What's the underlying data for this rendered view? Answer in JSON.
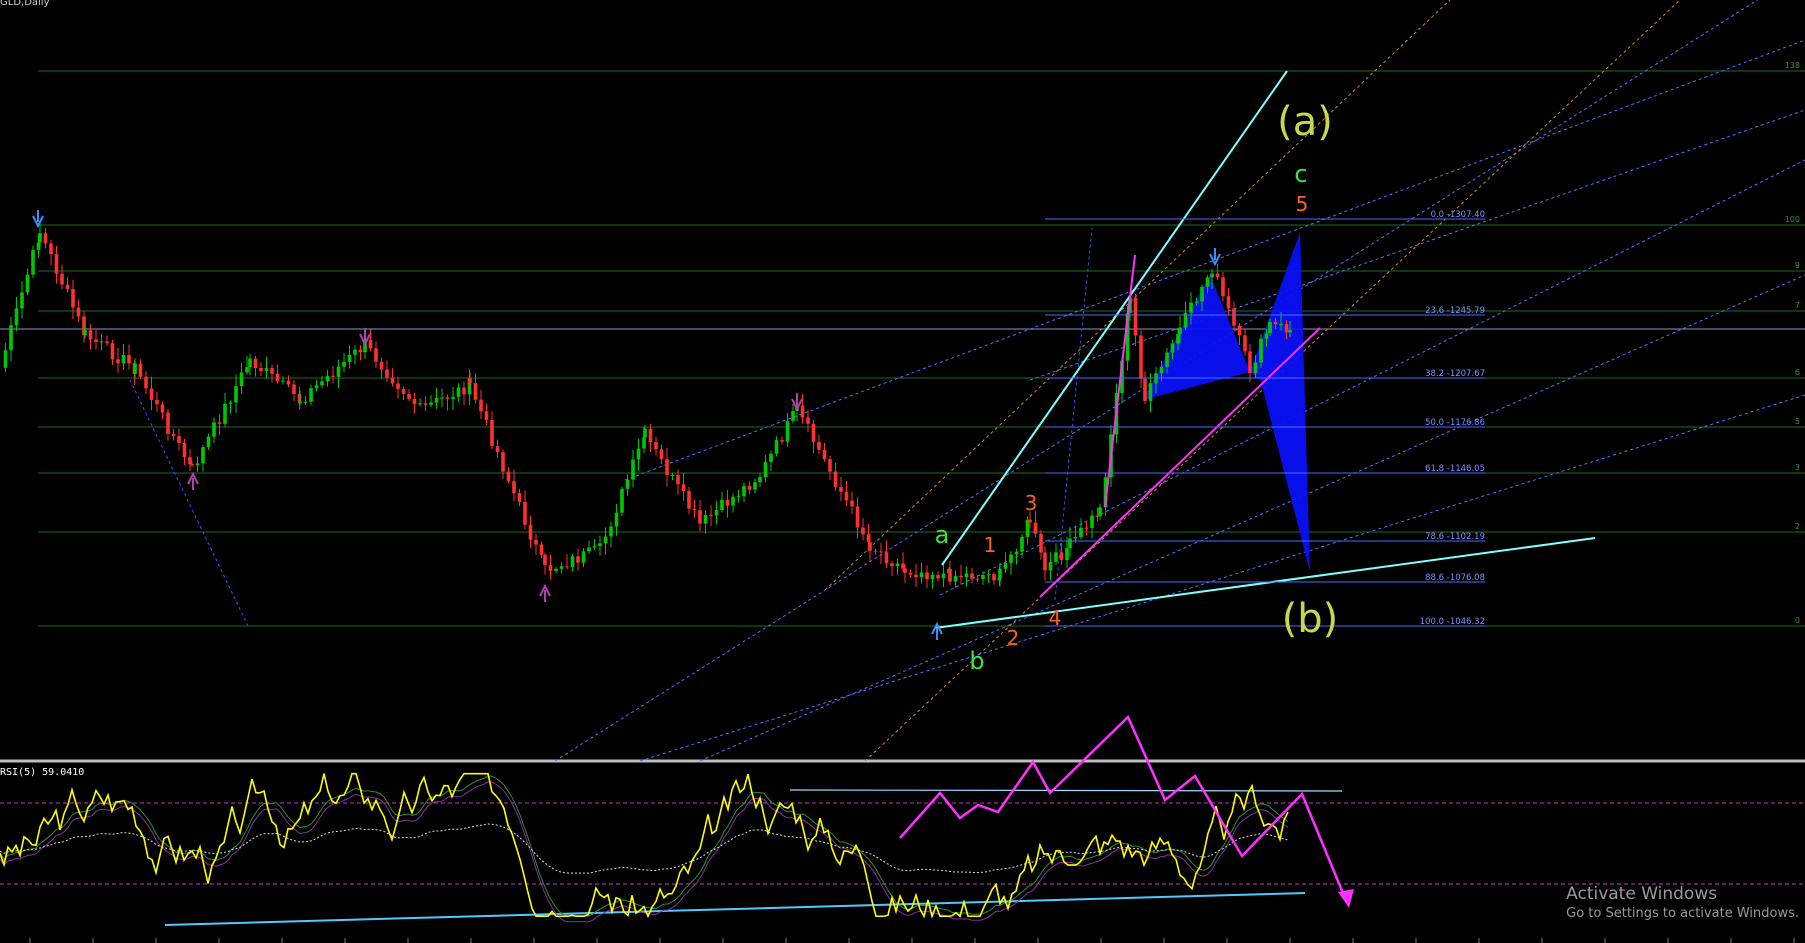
{
  "header": {
    "symbol_title": "GLD,Daily",
    "oscillator_title": "RSI(5) 59.0410"
  },
  "watermark": {
    "line1": "Activate Windows",
    "line2": "Go to Settings to activate Windows."
  },
  "colors": {
    "background": "#000000",
    "up_candle": "#00c800",
    "down_candle": "#ff3030",
    "fib_line": "#4a6cff",
    "green_level": "#1f6b1f",
    "trend_cyan": "#7fffff",
    "magenta": "#ff30ff",
    "pattern_blue": "#0a10ff",
    "rsi": "#ffff00",
    "orange_dotted": "#d08a10"
  },
  "chart_data": {
    "type": "candlestick",
    "price_ylim": [
      960,
      1480
    ],
    "fibonacci_levels": [
      {
        "label": "0.0 -1307.40",
        "level": 0.0,
        "price": 1307.4
      },
      {
        "label": "23.6 -1245.79",
        "level": 23.6,
        "price": 1245.79
      },
      {
        "label": "38.2 -1207.67",
        "level": 38.2,
        "price": 1207.67
      },
      {
        "label": "50.0 -1176.86",
        "level": 50.0,
        "price": 1176.86
      },
      {
        "label": "61.8 -1146.05",
        "level": 61.8,
        "price": 1146.05
      },
      {
        "label": "78.6 -1102.19",
        "level": 78.6,
        "price": 1102.19
      },
      {
        "label": "88.6 -1076.08",
        "level": 88.6,
        "price": 1076.08
      },
      {
        "label": "100.0 -1046.32",
        "level": 100.0,
        "price": 1046.32
      }
    ],
    "right_edge_labels": [
      "138",
      "100",
      "9",
      "7",
      "6",
      "5",
      "3",
      "2",
      "0"
    ],
    "wave_labels": {
      "big": [
        "(a)",
        "(b)"
      ],
      "green": [
        "a",
        "b",
        "c"
      ],
      "orange": [
        "1",
        "2",
        "3",
        "4",
        "5"
      ]
    },
    "oscillator": {
      "name": "RSI(5)",
      "value": 59.041,
      "ylim": [
        0,
        100
      ],
      "levels": [
        70,
        30
      ]
    }
  }
}
